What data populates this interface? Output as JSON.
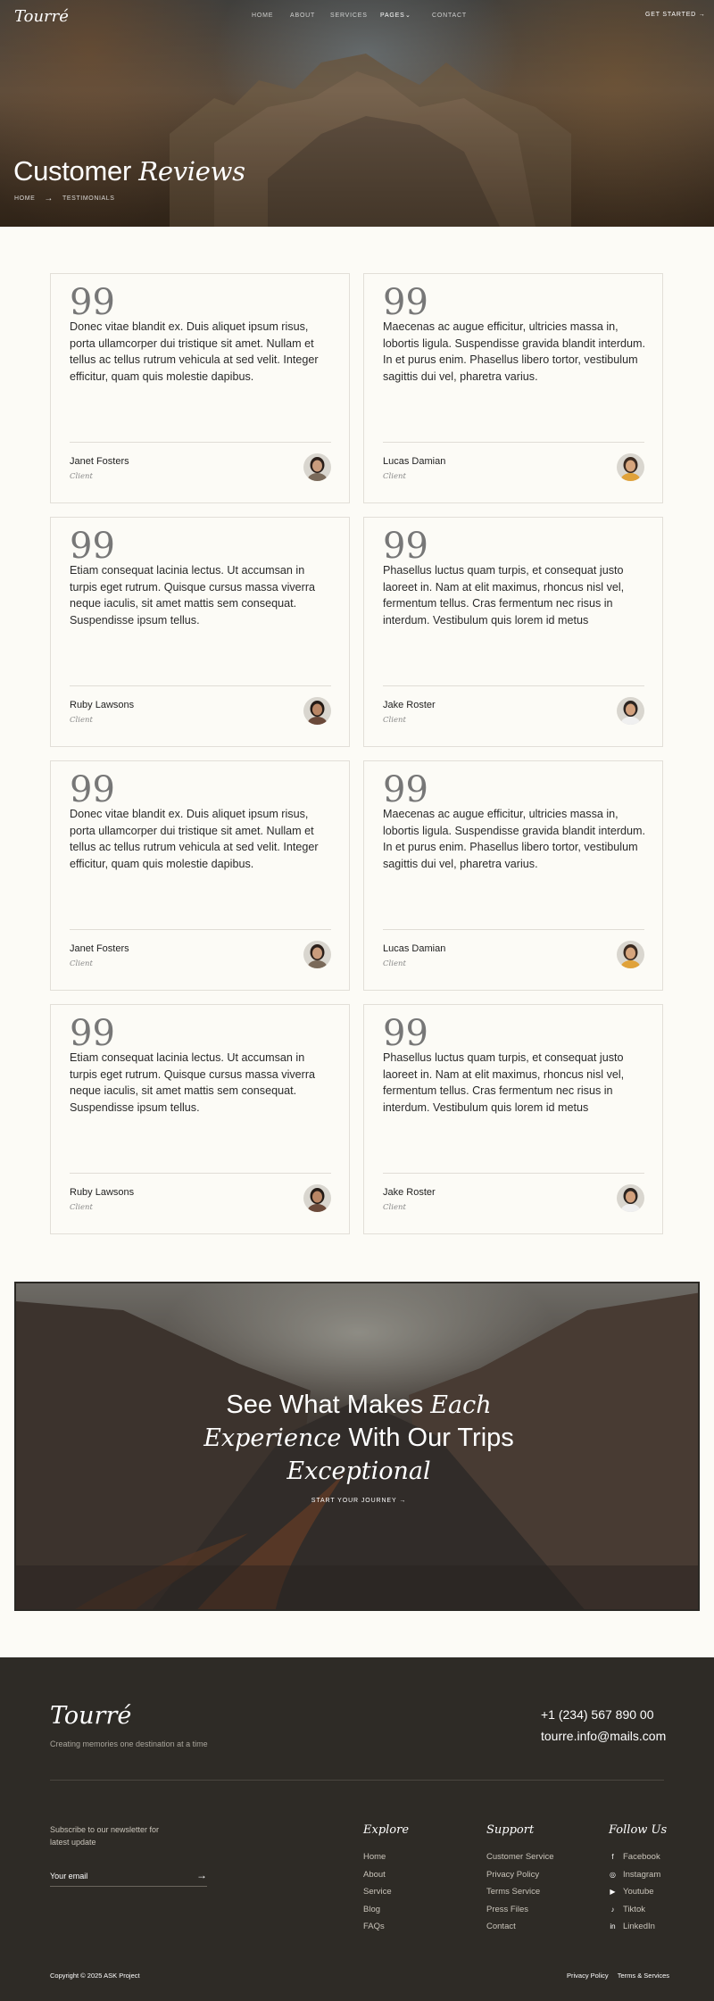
{
  "brand": "Tourré",
  "nav": {
    "items": [
      "HOME",
      "ABOUT",
      "SERVICES",
      "PAGES",
      "CONTACT"
    ],
    "cta": "GET STARTED"
  },
  "hero": {
    "title_plain": "Customer",
    "title_italic": "Reviews",
    "breadcrumb": [
      "HOME",
      "TESTIMONIALS"
    ]
  },
  "testimonials": [
    {
      "text": "Donec vitae blandit ex. Duis aliquet ipsum risus, porta ullamcorper dui tristique sit amet. Nullam et tellus ac tellus rutrum vehicula at sed velit. Integer efficitur, quam quis molestie dapibus.",
      "name": "Janet Fosters",
      "role": "Client"
    },
    {
      "text": "Maecenas ac augue efficitur, ultricies massa in, lobortis ligula. Suspendisse gravida blandit interdum. In et purus enim. Phasellus libero tortor, vestibulum sagittis dui vel, pharetra varius.",
      "name": "Lucas Damian",
      "role": "Client"
    },
    {
      "text": "Etiam consequat lacinia lectus. Ut accumsan in turpis eget rutrum. Quisque cursus massa viverra neque iaculis, sit amet mattis sem consequat. Suspendisse ipsum tellus.",
      "name": "Ruby Lawsons",
      "role": "Client"
    },
    {
      "text": "Phasellus luctus quam turpis, et consequat justo laoreet in. Nam at elit maximus, rhoncus nisl vel, fermentum tellus. Cras fermentum nec risus in interdum. Vestibulum quis lorem id metus",
      "name": "Jake Roster",
      "role": "Client"
    },
    {
      "text": "Donec vitae blandit ex. Duis aliquet ipsum risus, porta ullamcorper dui tristique sit amet. Nullam et tellus ac tellus rutrum vehicula at sed velit. Integer efficitur, quam quis molestie dapibus.",
      "name": "Janet Fosters",
      "role": "Client"
    },
    {
      "text": "Maecenas ac augue efficitur, ultricies massa in, lobortis ligula. Suspendisse gravida blandit interdum. In et purus enim. Phasellus libero tortor, vestibulum sagittis dui vel, pharetra varius.",
      "name": "Lucas Damian",
      "role": "Client"
    },
    {
      "text": "Etiam consequat lacinia lectus. Ut accumsan in turpis eget rutrum. Quisque cursus massa viverra neque iaculis, sit amet mattis sem consequat. Suspendisse ipsum tellus.",
      "name": "Ruby Lawsons",
      "role": "Client"
    },
    {
      "text": "Phasellus luctus quam turpis, et consequat justo laoreet in. Nam at elit maximus, rhoncus nisl vel, fermentum tellus. Cras fermentum nec risus in interdum. Vestibulum quis lorem id metus",
      "name": "Jake Roster",
      "role": "Client"
    }
  ],
  "banner": {
    "line1_plain": "See What Makes",
    "line1_italic": "Each",
    "line2_italic": "Experience",
    "line2_plain": "With Our Trips",
    "line3_italic": "Exceptional",
    "link": "START YOUR JOURNEY"
  },
  "footer": {
    "logo": "Tourré",
    "tagline": "Creating memories one destination at a time",
    "phone": "+1 (234) 567 890 00",
    "email": "tourre.info@mails.com",
    "newsletter_text": "Subscribe to our newsletter for latest update",
    "email_placeholder": "Your email",
    "explore_title": "Explore",
    "explore": [
      "Home",
      "About",
      "Service",
      "Blog",
      "FAQs"
    ],
    "support_title": "Support",
    "support": [
      "Customer Service",
      "Privacy Policy",
      "Terms Service",
      "Press Files",
      "Contact"
    ],
    "follow_title": "Follow Us",
    "follow": [
      {
        "label": "Facebook",
        "icon": "facebook-icon"
      },
      {
        "label": "Instagram",
        "icon": "instagram-icon"
      },
      {
        "label": "Youtube",
        "icon": "youtube-icon"
      },
      {
        "label": "Tiktok",
        "icon": "tiktok-icon"
      },
      {
        "label": "LinkedIn",
        "icon": "linkedin-icon"
      }
    ],
    "copyright": "Copyright © 2025 ASK Project",
    "legal": [
      "Privacy Policy",
      "Terms & Services"
    ]
  }
}
